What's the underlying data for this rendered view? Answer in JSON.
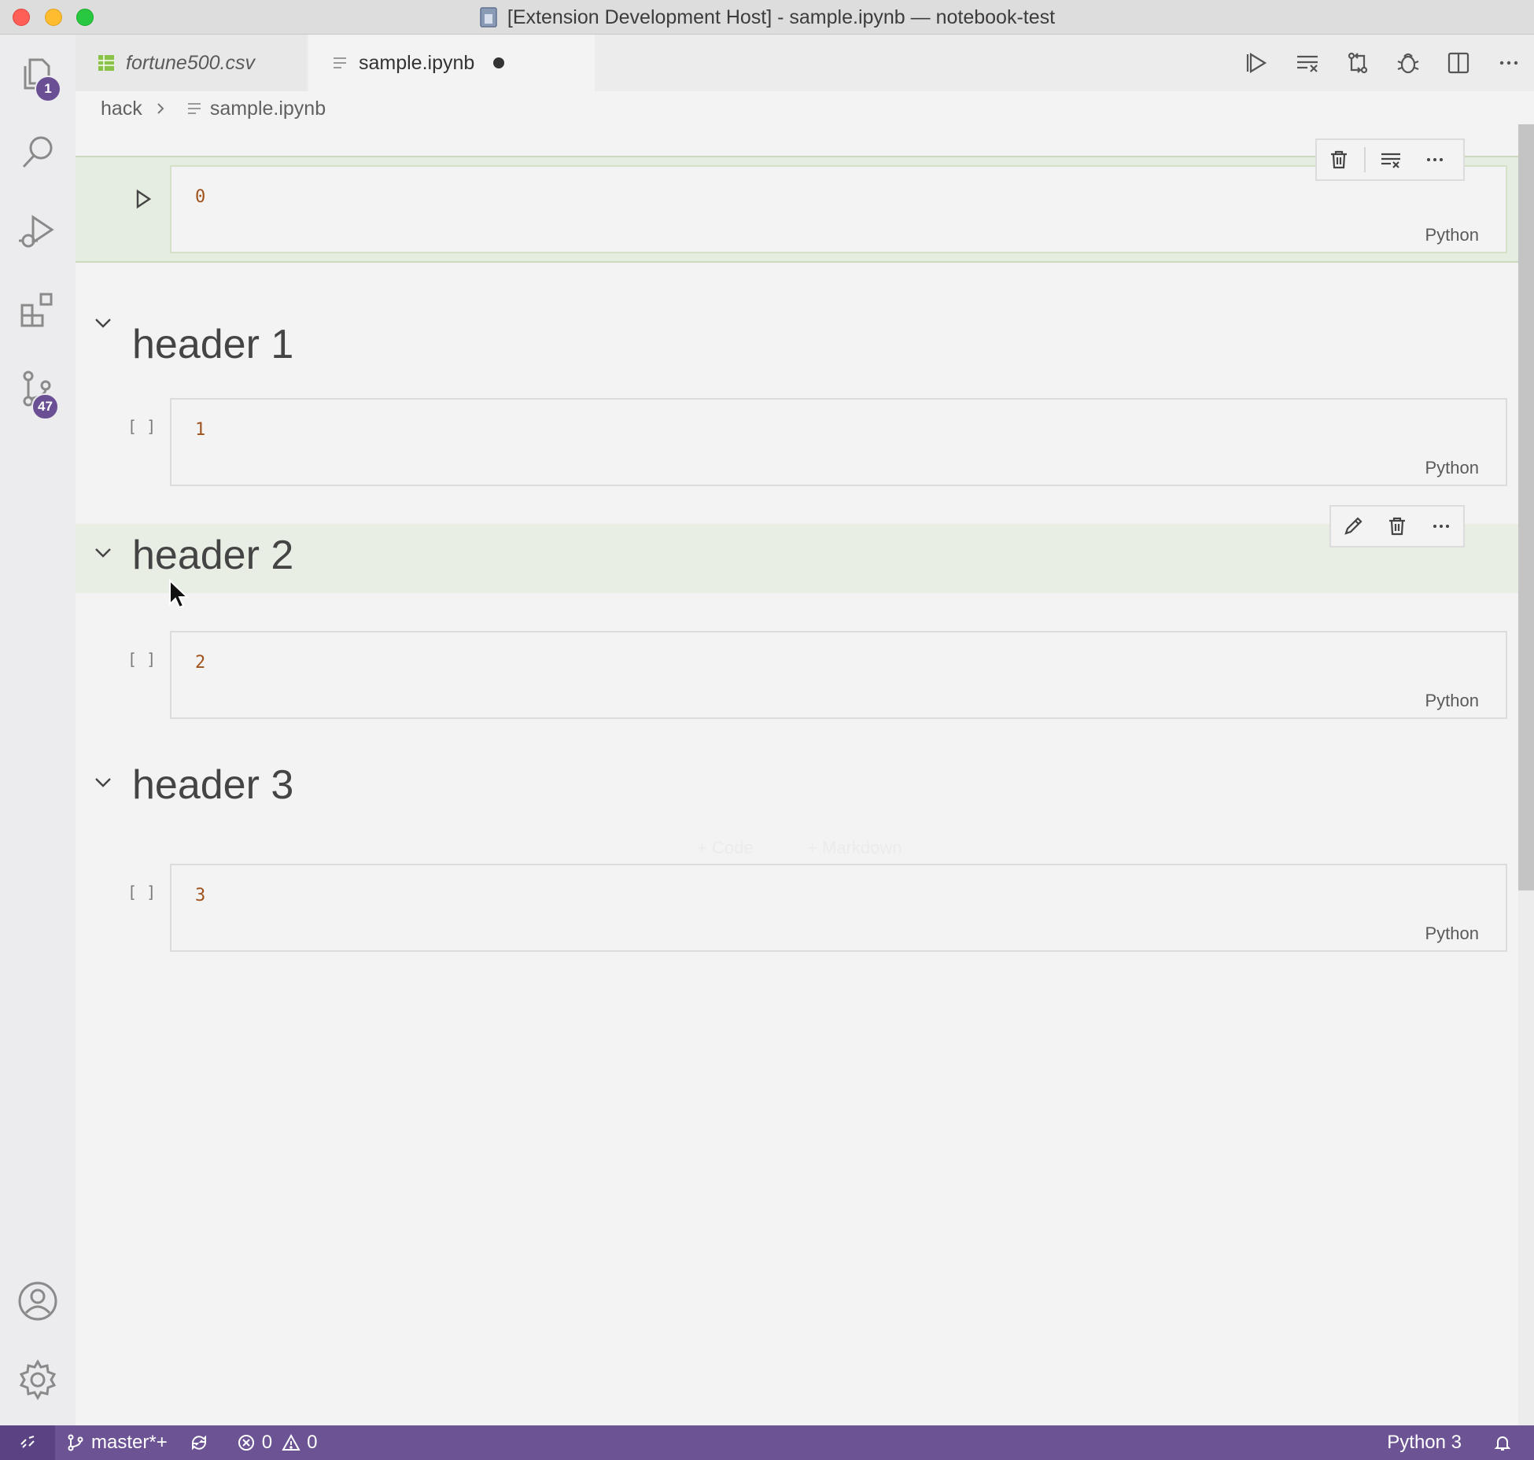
{
  "window": {
    "title": "[Extension Development Host] - sample.ipynb — notebook-test"
  },
  "activity_bar": {
    "explorer_badge": "1",
    "scm_badge": "47"
  },
  "tabs": [
    {
      "label": "fortune500.csv",
      "dirty": false,
      "active": false
    },
    {
      "label": "sample.ipynb",
      "dirty": true,
      "active": true
    }
  ],
  "breadcrumb": {
    "folder": "hack",
    "file": "sample.ipynb"
  },
  "cells": [
    {
      "kind": "code",
      "source": "0",
      "language": "Python",
      "exec_label": ""
    },
    {
      "kind": "markdown",
      "heading": "header 1"
    },
    {
      "kind": "code",
      "source": "1",
      "language": "Python",
      "exec_label": "[ ]"
    },
    {
      "kind": "markdown",
      "heading": "header 2"
    },
    {
      "kind": "code",
      "source": "2",
      "language": "Python",
      "exec_label": "[ ]"
    },
    {
      "kind": "markdown",
      "heading": "header 3"
    },
    {
      "kind": "code",
      "source": "3",
      "language": "Python",
      "exec_label": "[ ]"
    }
  ],
  "insert_hints": {
    "code": "+ Code",
    "markdown": "+ Markdown"
  },
  "status_bar": {
    "branch": "master*+",
    "errors": "0",
    "warnings": "0",
    "kernel": "Python 3"
  },
  "colors": {
    "accent_statusbar": "#6c5494",
    "badge": "#6b4f94",
    "focused_cell": "#e5ece0",
    "code_text": "#a0521c"
  }
}
